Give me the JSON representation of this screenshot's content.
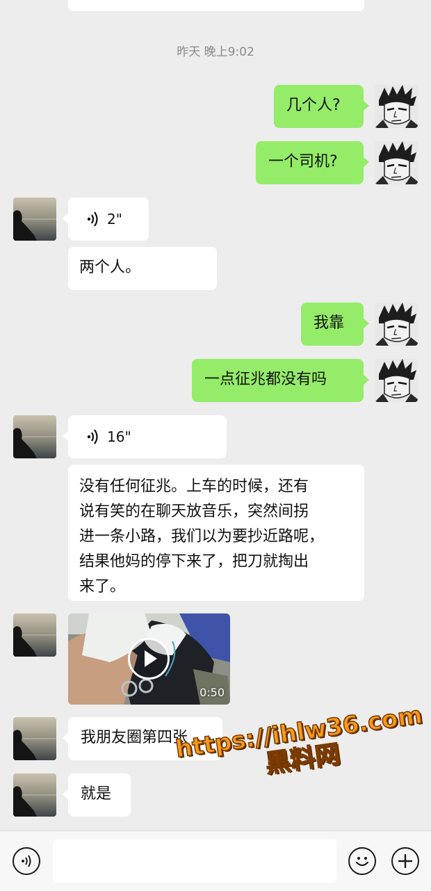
{
  "timestamp": "昨天 晚上9:02",
  "messages": [
    {
      "side": "out",
      "type": "text",
      "text": "几个人?"
    },
    {
      "side": "out",
      "type": "text",
      "text": "一个司机?"
    },
    {
      "side": "in",
      "type": "voice",
      "duration": "2\""
    },
    {
      "side": "in",
      "type": "text",
      "text": "两个人。"
    },
    {
      "side": "out",
      "type": "text",
      "text": "我靠"
    },
    {
      "side": "out",
      "type": "text",
      "text": "一点征兆都没有吗"
    },
    {
      "side": "in",
      "type": "voice",
      "duration": "16\""
    },
    {
      "side": "in",
      "type": "text",
      "lines": [
        "没有任何征兆。上车的时候，还有",
        "说有笑的在聊天放音乐，突然间拐",
        "进一条小路，我们以为要抄近路呢，",
        "结果他妈的停下来了，把刀就掏出",
        "来了。"
      ]
    },
    {
      "side": "in",
      "type": "video",
      "duration": "0:50"
    },
    {
      "side": "in",
      "type": "text",
      "text": "我朋友圈第四张"
    },
    {
      "side": "in",
      "type": "text",
      "text": "就是"
    }
  ],
  "watermark": {
    "url": "https://ihlw36.com",
    "label": "黑料网",
    "color": "#f59a1e"
  },
  "input_bar": {
    "voice_icon": "voice-icon",
    "emoji_icon": "emoji-icon",
    "plus_icon": "plus-icon"
  },
  "colors": {
    "background": "#ededed",
    "bubble_out": "#95ec69",
    "bubble_in": "#ffffff"
  }
}
